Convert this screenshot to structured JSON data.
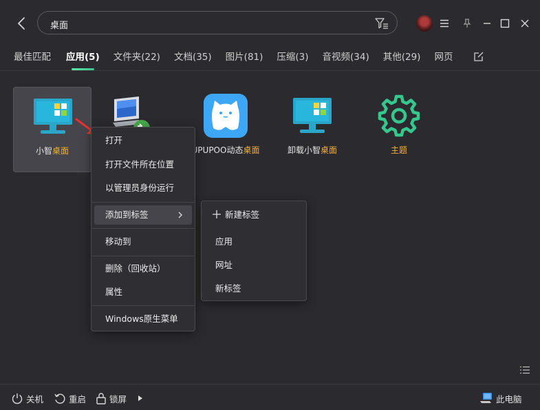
{
  "search": {
    "value": "桌面"
  },
  "tabs": [
    {
      "label": "最佳匹配"
    },
    {
      "label": "应用(5)"
    },
    {
      "label": "文件夹(22)"
    },
    {
      "label": "文档(35)"
    },
    {
      "label": "图片(81)"
    },
    {
      "label": "压缩(3)"
    },
    {
      "label": "音视频(34)"
    },
    {
      "label": "其他(29)"
    },
    {
      "label": "网页"
    }
  ],
  "tiles": [
    {
      "prefix": "小智",
      "highlight": "桌面",
      "icon": "monitor-app-icon"
    },
    {
      "prefix": "",
      "highlight": "",
      "icon": "remote-desktop-icon"
    },
    {
      "prefix": "UPUPOO动态",
      "highlight": "桌面",
      "icon": "upupoo-cat-icon"
    },
    {
      "prefix": "卸载小智",
      "highlight": "桌面",
      "icon": "monitor-app-icon"
    },
    {
      "prefix": "",
      "highlight": "主题",
      "icon": "gear-icon"
    }
  ],
  "context_menu": {
    "items": [
      "打开",
      "打开文件所在位置",
      "以管理员身份运行",
      "添加到标签",
      "移动到",
      "删除（回收站）",
      "属性",
      "Windows原生菜单"
    ]
  },
  "submenu": {
    "new_tag": "新建标签",
    "items": [
      "应用",
      "网址",
      "新标签"
    ]
  },
  "bottom": {
    "shutdown": "关机",
    "restart": "重启",
    "lock": "锁屏",
    "this_pc": "此电脑"
  },
  "colors": {
    "background": "#2b2b2f",
    "highlight": "#f2b134",
    "accent": "#3cc48a",
    "menu_bg": "#2e2e33"
  }
}
